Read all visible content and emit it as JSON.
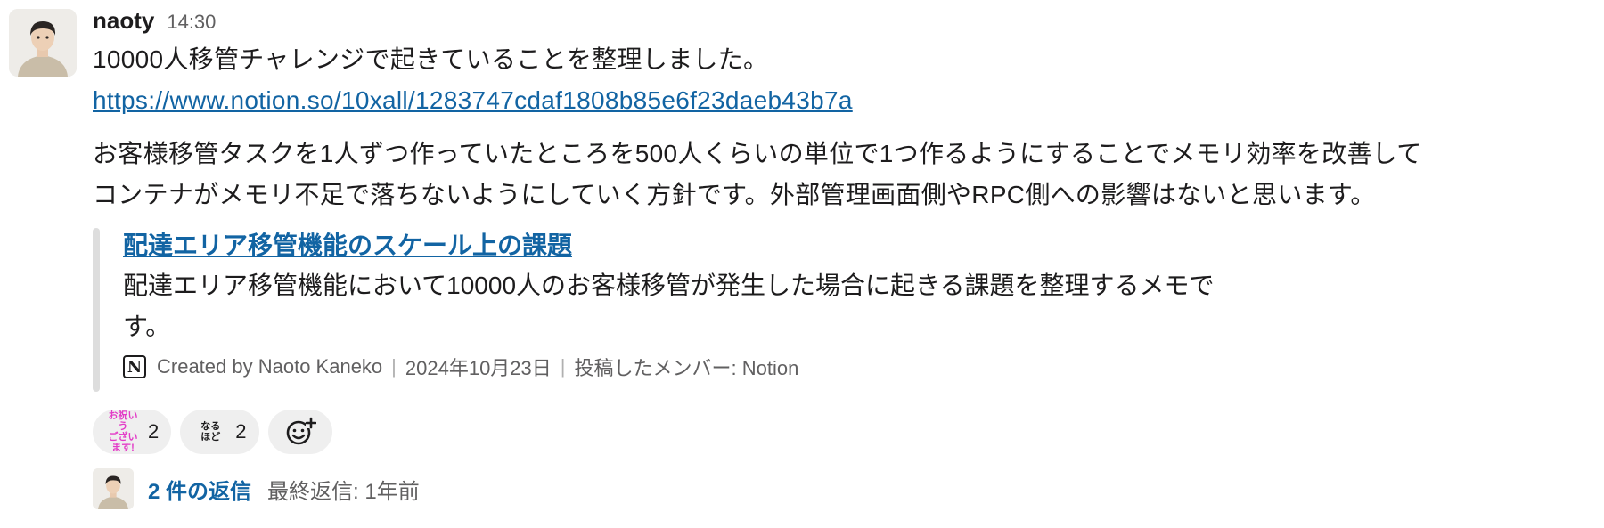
{
  "message": {
    "author": "naoty",
    "time": "14:30",
    "line1": "10000人移管チャレンジで起きていることを整理しました。",
    "link": "https://www.notion.so/10xall/1283747cdaf1808b85e6f23daeb43b7a",
    "para2_line1": "お客様移管タスクを1人ずつ作っていたところを500人くらいの単位で1つ作るようにすることでメモリ効率を改善して",
    "para2_line2": "コンテナがメモリ不足で落ちないようにしていく方針です。外部管理画面側やRPC側への影響はないと思います。"
  },
  "unfurl": {
    "title": "配達エリア移管機能のスケール上の課題",
    "description": "配達エリア移管機能において10000人のお客様移管が発生した場合に起きる課題を整理するメモです。",
    "icon": "notion-icon",
    "created_by": "Created by Naoto Kaneko",
    "date": "2024年10月23日",
    "posted_by": "投稿したメンバー: Notion"
  },
  "reactions": [
    {
      "emoji_text": "お祝いう\nございます!",
      "emoji_color": "#e33bc7",
      "count": "2"
    },
    {
      "emoji_text": "なる\nほど",
      "emoji_color": "#1d1c1d",
      "count": "2"
    }
  ],
  "thread": {
    "reply_count": "2 件の返信",
    "last_reply": "最終返信: 1年前"
  }
}
